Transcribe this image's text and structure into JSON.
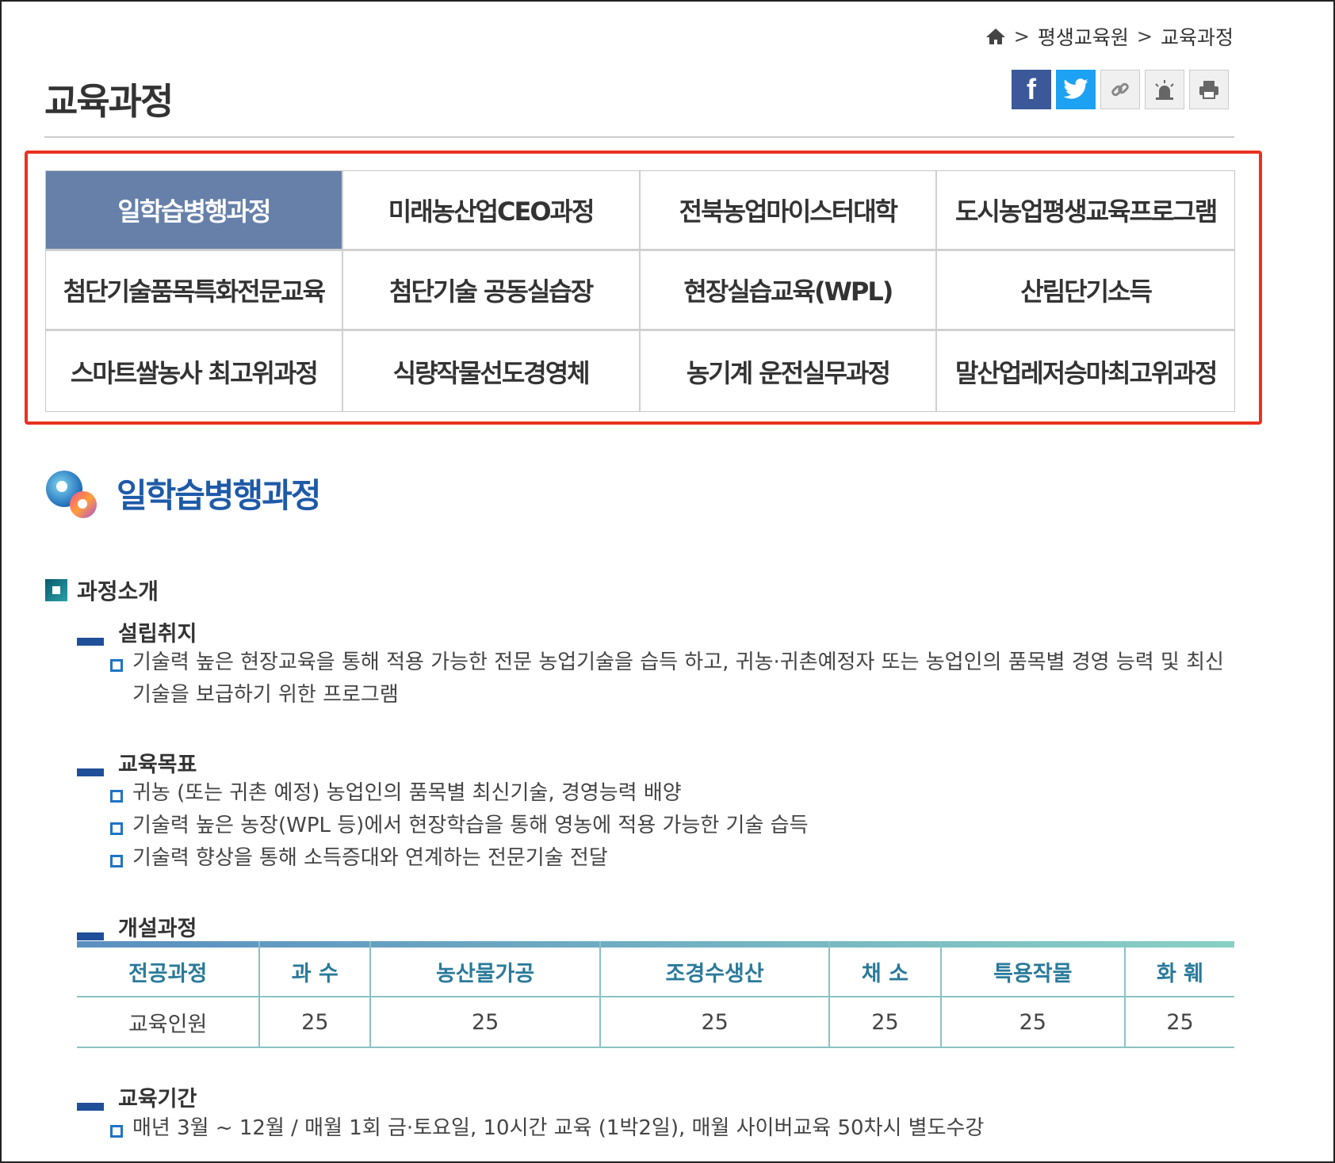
{
  "breadcrumb": {
    "items": [
      "평생교육원",
      "교육과정"
    ],
    "separator": ">"
  },
  "page_title": "교육과정",
  "share": {
    "facebook": "f"
  },
  "menu": {
    "items": [
      "일학습병행과정",
      "미래농산업CEO과정",
      "전북농업마이스터대학",
      "도시농업평생교육프로그램",
      "첨단기술품목특화전문교육",
      "첨단기술 공동실습장",
      "현장실습교육(WPL)",
      "산림단기소득",
      "스마트쌀농사 최고위과정",
      "식량작물선도경영체",
      "농기계 운전실무과정",
      "말산업레저승마최고위과정"
    ],
    "active_index": 0
  },
  "section": {
    "title": "일학습병행과정",
    "intro_heading": "과정소개",
    "purpose": {
      "heading": "설립취지",
      "items": [
        "기술력 높은 현장교육을 통해 적용 가능한 전문 농업기술을 습득 하고, 귀농·귀촌예정자 또는 농업인의 품목별 경영 능력 및 최신 기술을 보급하기 위한 프로그램"
      ]
    },
    "goals": {
      "heading": "교육목표",
      "items": [
        "귀농 (또는 귀촌 예정) 농업인의 품목별 최신기술, 경영능력 배양",
        "기술력 높은 농장(WPL 등)에서 현장학습을 통해 영농에 적용 가능한 기술 습득",
        "기술력 향상을 통해 소득증대와 연계하는 전문기술 전달"
      ]
    },
    "courses": {
      "heading": "개설과정",
      "headers": [
        "전공과정",
        "과 수",
        "농산물가공",
        "조경수생산",
        "채 소",
        "특용작물",
        "화 훼"
      ],
      "row": [
        "교육인원",
        "25",
        "25",
        "25",
        "25",
        "25",
        "25"
      ]
    },
    "period": {
      "heading": "교육기간",
      "items": [
        "매년 3월 ~ 12월 / 매월 1회 금·토요일, 10시간 교육 (1박2일), 매월 사이버교육 50차시 별도수강"
      ]
    }
  },
  "colors": {
    "accent_red": "#e8321f",
    "active_menu": "#6680aa",
    "title_blue": "#1e5aa8"
  },
  "icons": [
    "home-icon",
    "facebook-icon",
    "twitter-icon",
    "link-icon",
    "alert-icon",
    "print-icon",
    "section-circle-icon"
  ]
}
